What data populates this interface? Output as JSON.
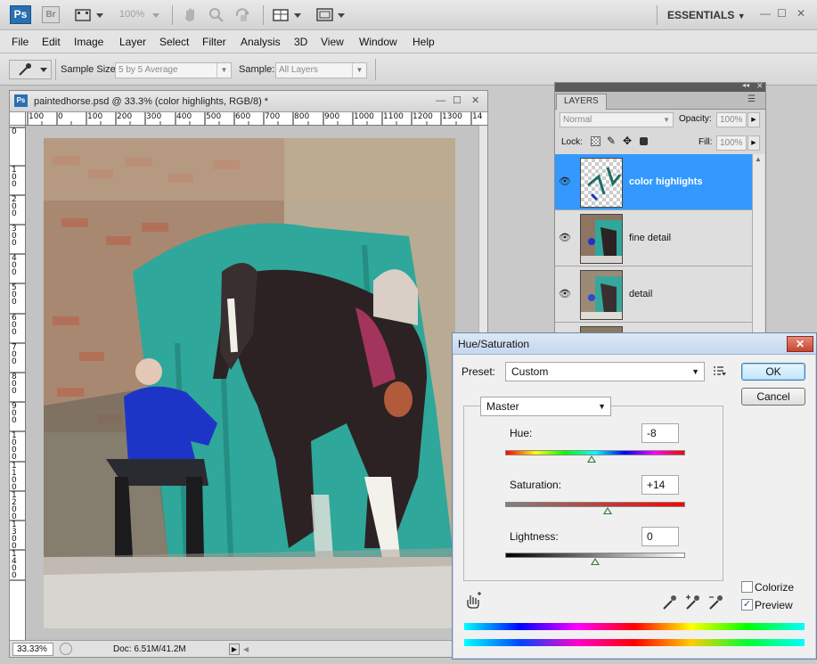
{
  "appbar": {
    "ps_logo": "Ps",
    "br_logo": "Br",
    "zoom": "100%",
    "workspace": "ESSENTIALS",
    "workspace_arrow": "▼",
    "win_min": "—",
    "win_max": "☐",
    "win_close": "✕",
    "icons": [
      "screen-mode-icon",
      "hand-icon",
      "zoom-icon",
      "rotate-view-icon",
      "arrange-documents-icon",
      "screen-mode-toggle-icon"
    ]
  },
  "menubar": {
    "items": [
      "File",
      "Edit",
      "Image",
      "Layer",
      "Select",
      "Filter",
      "Analysis",
      "3D",
      "View",
      "Window",
      "Help"
    ]
  },
  "options": {
    "tool": "eyedropper-icon",
    "sample_size_label": "Sample Size:",
    "sample_size_value": "5 by 5 Average",
    "sample_label": "Sample:",
    "sample_value": "All Layers"
  },
  "document": {
    "title": "paintedhorse.psd @ 33.3% (color highlights, RGB/8) *",
    "ruler_h": [
      "100",
      "0",
      "100",
      "200",
      "300",
      "400",
      "500",
      "600",
      "700",
      "800",
      "900",
      "1000",
      "1100",
      "1200",
      "1300",
      "14"
    ],
    "ruler_v": [
      "0",
      "1\n0\n0",
      "2\n0\n0",
      "3\n0\n0",
      "4\n0\n0",
      "5\n0\n0",
      "6\n0\n0",
      "7\n0\n0",
      "8\n0\n0",
      "9\n0\n0",
      "1\n0\n0\n0",
      "1\n1\n0\n0",
      "1\n2\n0\n0",
      "1\n3\n0\n0",
      "1\n4\n0\n0"
    ],
    "zoom": "33.33%",
    "doc_info": "Doc: 6.51M/41.2M"
  },
  "layers": {
    "tab": "LAYERS",
    "blend_mode": "Normal",
    "opacity_label": "Opacity:",
    "opacity_value": "100%",
    "lock_label": "Lock:",
    "fill_label": "Fill:",
    "fill_value": "100%",
    "rows": [
      {
        "name": "color highlights",
        "selected": true
      },
      {
        "name": "fine detail",
        "selected": false
      },
      {
        "name": "detail",
        "selected": false
      }
    ]
  },
  "hue_saturation": {
    "title": "Hue/Saturation",
    "close": "✕",
    "preset_label": "Preset:",
    "preset_value": "Custom",
    "ok": "OK",
    "cancel": "Cancel",
    "channel": "Master",
    "hue_label": "Hue:",
    "hue_value": "-8",
    "saturation_label": "Saturation:",
    "saturation_value": "+14",
    "lightness_label": "Lightness:",
    "lightness_value": "0",
    "hue_position": 0.48,
    "saturation_position": 0.57,
    "lightness_position": 0.5,
    "colorize_label": "Colorize",
    "colorize_checked": false,
    "preview_label": "Preview",
    "preview_checked": true,
    "check_mark": "✓"
  }
}
